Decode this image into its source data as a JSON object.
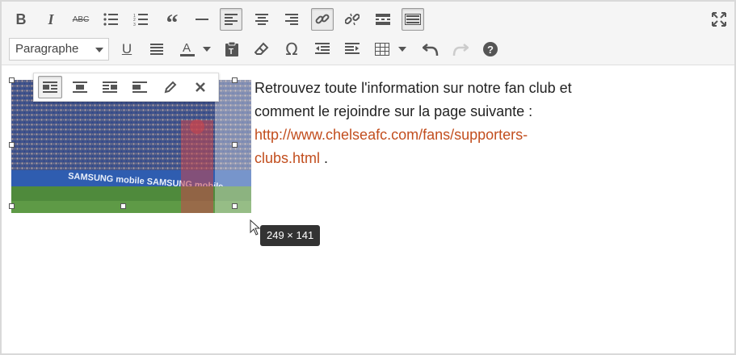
{
  "toolbar": {
    "row1": [
      {
        "name": "bold-button",
        "icon": "bold-icon"
      },
      {
        "name": "italic-button",
        "icon": "italic-icon"
      },
      {
        "name": "strikethrough-button",
        "icon": "strikethrough-icon"
      },
      {
        "name": "bullet-list-button",
        "icon": "bullet-list-icon"
      },
      {
        "name": "numbered-list-button",
        "icon": "numbered-list-icon"
      },
      {
        "name": "blockquote-button",
        "icon": "quote-icon"
      },
      {
        "name": "horizontal-rule-button",
        "icon": "hr-icon"
      },
      {
        "name": "align-left-button",
        "icon": "align-left-icon",
        "active": true
      },
      {
        "name": "align-center-button",
        "icon": "align-center-icon"
      },
      {
        "name": "align-right-button",
        "icon": "align-right-icon"
      },
      {
        "name": "insert-link-button",
        "icon": "link-icon",
        "active": true
      },
      {
        "name": "remove-link-button",
        "icon": "unlink-icon"
      },
      {
        "name": "read-more-button",
        "icon": "read-more-icon"
      },
      {
        "name": "toolbar-toggle-button",
        "icon": "keyboard-icon",
        "active": true
      }
    ],
    "format_select": {
      "value": "Paragraphe"
    },
    "fullscreen_icon": "fullscreen-icon"
  },
  "image_toolbar": {
    "buttons": [
      "align-left-icon",
      "align-center-icon",
      "align-right-icon",
      "align-none-icon",
      "edit-icon",
      "remove-icon"
    ]
  },
  "content": {
    "text_before": "Retrouvez toute l'information sur notre fan club et comment le rejoindre sur la page suivante :",
    "link_line1": "http://www.chelseafc.com/fans/supporters-",
    "link_line2": "clubs.html",
    "text_after": " .",
    "link_color": "#c24e1e"
  },
  "image": {
    "size_tooltip": "249 × 141",
    "alt": "stadium crowd photo"
  }
}
